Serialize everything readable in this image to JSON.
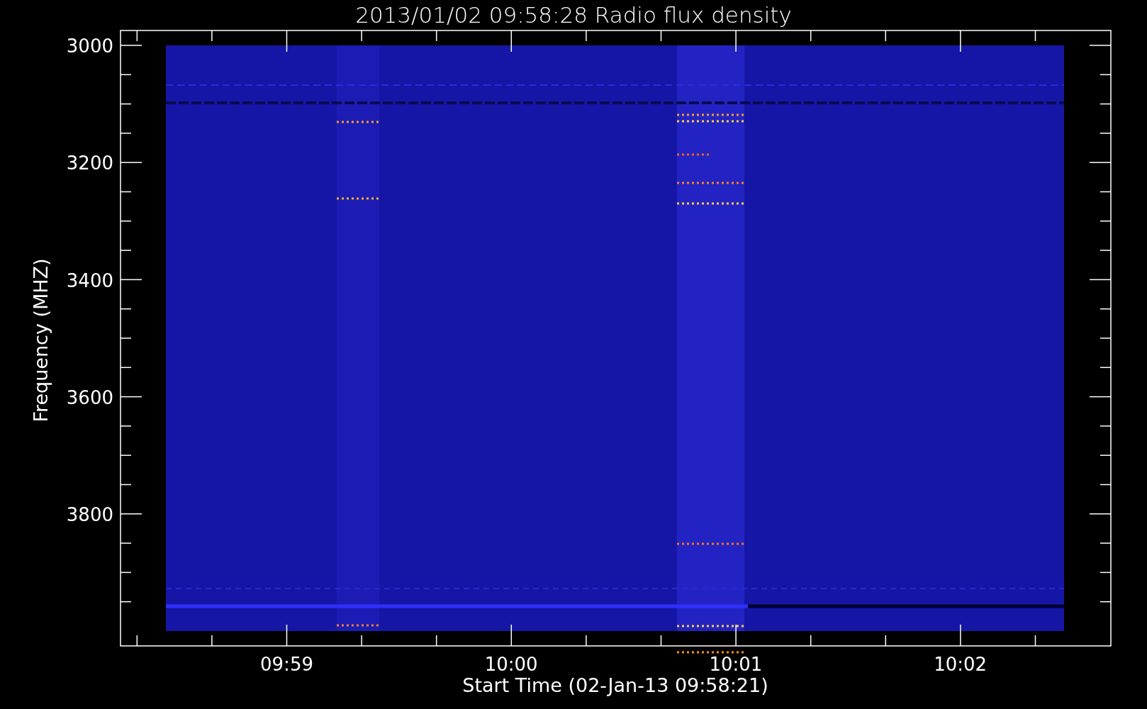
{
  "title": "2013/01/02 09:58:28 Radio flux density",
  "y_axis": {
    "label": "Frequency (MHZ)",
    "ticks": [
      "3000",
      "3200",
      "3400",
      "3600",
      "3800"
    ]
  },
  "x_axis": {
    "label": "Start Time (02-Jan-13 09:58:21)",
    "ticks": [
      "09:59",
      "10:00",
      "10:01",
      "10:02"
    ]
  }
}
